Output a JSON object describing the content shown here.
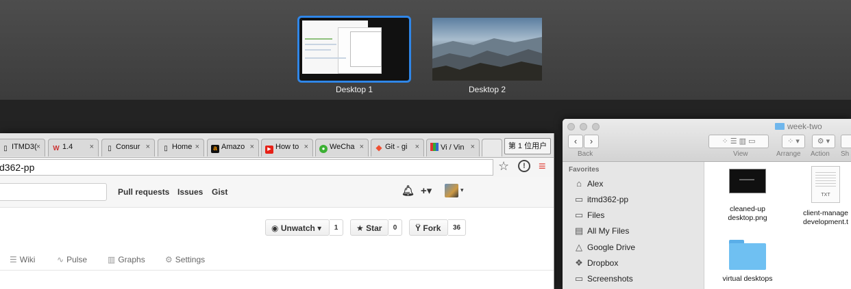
{
  "mission_control": {
    "desktops": [
      {
        "label": "Desktop 1",
        "selected": true
      },
      {
        "label": "Desktop 2",
        "selected": false
      }
    ],
    "accent": "#2f86e8"
  },
  "chrome": {
    "tabs": [
      {
        "label": "ITMD3(",
        "icon": "page-icon"
      },
      {
        "label": "1.4",
        "icon": "w-logo-icon"
      },
      {
        "label": "Consur",
        "icon": "page-icon"
      },
      {
        "label": "Home",
        "icon": "page-icon"
      },
      {
        "label": "Amazo",
        "icon": "amazon-icon"
      },
      {
        "label": "How to",
        "icon": "youtube-icon"
      },
      {
        "label": "WeCha",
        "icon": "wechat-icon"
      },
      {
        "label": "Git - gi",
        "icon": "git-icon"
      },
      {
        "label": "Vi / Vin",
        "icon": "grid-icon"
      }
    ],
    "tab_close": "×",
    "ime_label": "第 1 位用户",
    "omnibox": "d362-pp",
    "github": {
      "nav": [
        "Pull requests",
        "Issues",
        "Gist"
      ],
      "header_icons": {
        "bell": "🔔",
        "plus": "+▾"
      },
      "unwatch": {
        "label": "Unwatch ▾",
        "count": "1"
      },
      "star": {
        "label": "Star",
        "count": "0"
      },
      "fork": {
        "label": "Fork",
        "count": "36"
      },
      "repo_nav": [
        {
          "label": "Wiki",
          "icon": "☰"
        },
        {
          "label": "Pulse",
          "icon": "∿"
        },
        {
          "label": "Graphs",
          "icon": "▥"
        },
        {
          "label": "Settings",
          "icon": "⚙"
        }
      ]
    }
  },
  "finder": {
    "title": "week-two",
    "toolbar_labels": {
      "back": "Back",
      "view": "View",
      "arrange": "Arrange",
      "action": "Action",
      "share": "Sh"
    },
    "sidebar_title": "Favorites",
    "sidebar": [
      {
        "label": "Alex",
        "icon": "home-icon",
        "glyph": "⌂"
      },
      {
        "label": "itmd362-pp",
        "icon": "folder-icon",
        "glyph": "▭"
      },
      {
        "label": "Files",
        "icon": "folder-icon",
        "glyph": "▭"
      },
      {
        "label": "All My Files",
        "icon": "all-files-icon",
        "glyph": "▤"
      },
      {
        "label": "Google Drive",
        "icon": "google-drive-icon",
        "glyph": "△"
      },
      {
        "label": "Dropbox",
        "icon": "dropbox-icon",
        "glyph": "❖"
      },
      {
        "label": "Screenshots",
        "icon": "folder-icon",
        "glyph": "▭"
      }
    ],
    "files": [
      {
        "name_line1": "cleaned-up",
        "name_line2": "desktop.png"
      },
      {
        "name_line1": "client-manage",
        "name_line2": "development.t",
        "badge": "TXT"
      },
      {
        "name_line1": "virtual desktops",
        "name_line2": ""
      }
    ]
  }
}
